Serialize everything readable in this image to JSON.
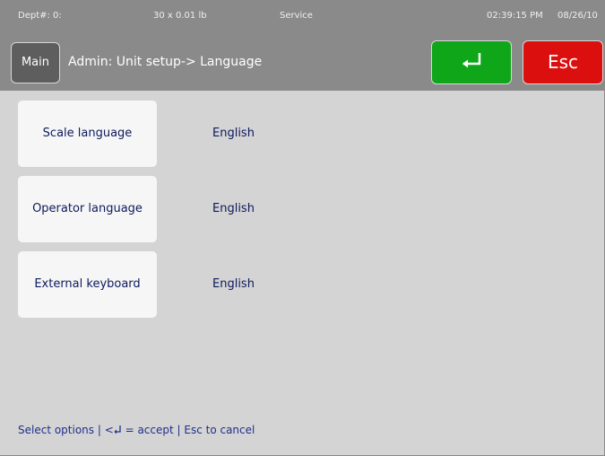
{
  "status_bar": {
    "dept": "Dept#: 0:",
    "weight": "30 x 0.01 lb",
    "mode": "Service",
    "time": "02:39:15 PM",
    "date": "08/26/10"
  },
  "header": {
    "main_label": "Main",
    "title": "Admin: Unit setup-> Language",
    "accept_icon": "enter-icon",
    "esc_label": "Esc"
  },
  "settings": [
    {
      "label": "Scale language",
      "value": "English"
    },
    {
      "label": "Operator language",
      "value": "English"
    },
    {
      "label": "External keyboard",
      "value": "English"
    }
  ],
  "hint": {
    "before": "Select options | <",
    "icon": "enter-icon",
    "after": " = accept | Esc to cancel"
  },
  "colors": {
    "background": "#d4d4d4",
    "header": "#8a8a8a",
    "accept": "#0fa619",
    "escape": "#dc0f0f",
    "text": "#0d1a5c"
  }
}
